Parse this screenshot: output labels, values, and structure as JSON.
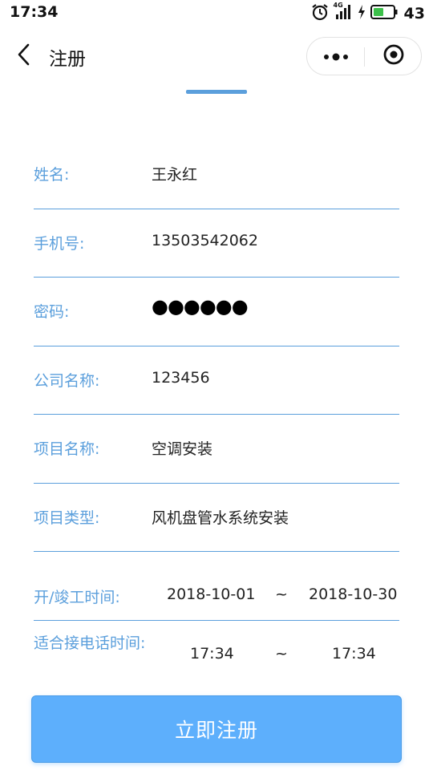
{
  "status_bar": {
    "time": "17:34",
    "network": "4G",
    "battery": "43"
  },
  "nav": {
    "title": "注册",
    "back_icon": "chevron-left-icon",
    "more_icon": "more-dots-icon",
    "close_icon": "target-circle-icon"
  },
  "form": {
    "name": {
      "label": "姓名:",
      "value": "王永红"
    },
    "phone": {
      "label": "手机号:",
      "value": "13503542062"
    },
    "password": {
      "label": "密码:",
      "value": "●●●●●●"
    },
    "company": {
      "label": "公司名称:",
      "value": "123456"
    },
    "project_name": {
      "label": "项目名称:",
      "value": "空调安装"
    },
    "project_type": {
      "label": "项目类型:",
      "value": "风机盘管水系统安装"
    },
    "dates": {
      "label": "开/竣工时间:",
      "start": "2018-10-01",
      "separator": "~",
      "end": "2018-10-30"
    },
    "call_time": {
      "label": "适合接电话时间:",
      "start": "17:34",
      "separator": "~",
      "end": "17:34"
    }
  },
  "submit_label": "立即注册",
  "colors": {
    "accent": "#5b9fdc",
    "button": "#5daffc"
  }
}
